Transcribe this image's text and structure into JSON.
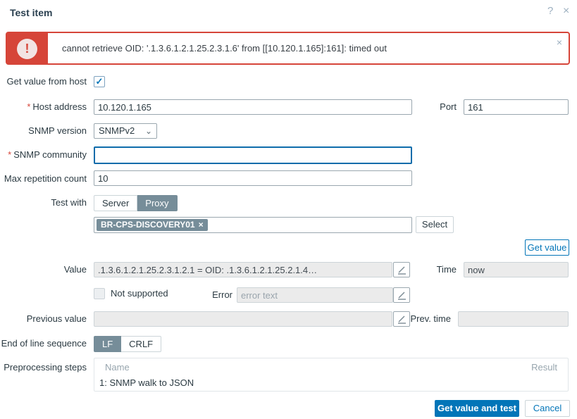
{
  "dialog": {
    "title": "Test item"
  },
  "icons": {
    "help": "?",
    "close": "×",
    "dismiss": "×",
    "check": "✓",
    "chevron_down": "⌄",
    "chip_remove": "×"
  },
  "error_banner": {
    "message": "cannot retrieve OID: '.1.3.6.1.2.1.25.2.3.1.6' from [[10.120.1.165]:161]: timed out"
  },
  "form": {
    "get_value_from_host": {
      "label": "Get value from host",
      "checked": true
    },
    "host_address": {
      "label": "Host address",
      "required_mark": "*",
      "value": "10.120.1.165"
    },
    "port": {
      "label": "Port",
      "value": "161"
    },
    "snmp_version": {
      "label": "SNMP version",
      "value": "SNMPv2"
    },
    "snmp_community": {
      "label": "SNMP community",
      "required_mark": "*",
      "value": ""
    },
    "max_repetition_count": {
      "label": "Max repetition count",
      "value": "10"
    },
    "test_with": {
      "label": "Test with",
      "options": [
        "Server",
        "Proxy"
      ],
      "selected": "Proxy"
    },
    "proxy": {
      "chip": "BR-CPS-DISCOVERY01",
      "select_button": "Select"
    },
    "get_value_button": "Get value",
    "value_field": {
      "label": "Value",
      "value": ".1.3.6.1.2.1.25.2.3.1.2.1 = OID: .1.3.6.1.2.1.25.2.1.4…"
    },
    "time_field": {
      "label": "Time",
      "value": "now"
    },
    "not_supported": {
      "label": "Not supported",
      "checked": false
    },
    "error_field": {
      "label": "Error",
      "placeholder": "error text",
      "value": ""
    },
    "previous_value": {
      "label": "Previous value",
      "value": ""
    },
    "prev_time": {
      "label": "Prev. time",
      "value": ""
    },
    "eol": {
      "label": "End of line sequence",
      "options": [
        "LF",
        "CRLF"
      ],
      "selected": "LF"
    },
    "preprocessing": {
      "label": "Preprocessing steps",
      "columns": [
        "Name",
        "Result"
      ],
      "rows": [
        {
          "name": "1: SNMP walk to JSON",
          "result": ""
        }
      ]
    }
  },
  "footer": {
    "submit": "Get value and test",
    "cancel": "Cancel"
  },
  "colors": {
    "accent": "#0275b8",
    "error_red": "#d64539",
    "slate": "#768d99"
  }
}
